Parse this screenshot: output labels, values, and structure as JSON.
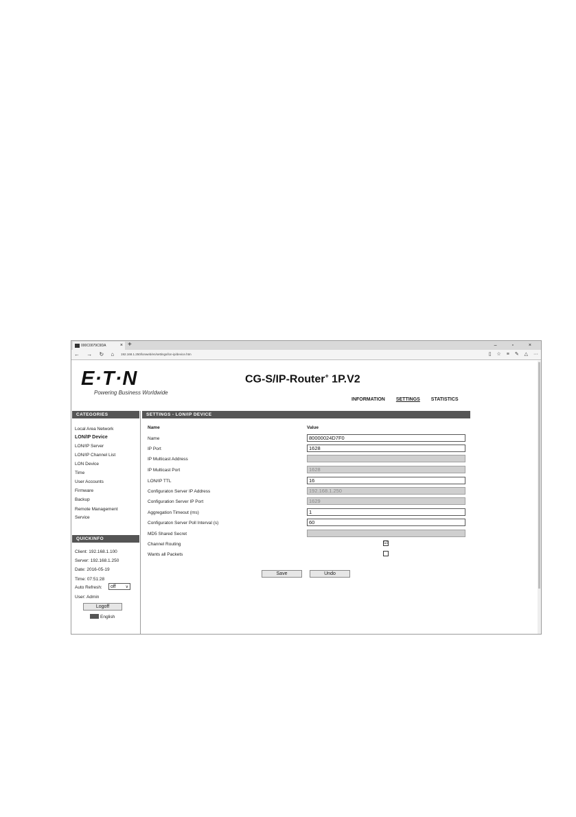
{
  "browser": {
    "tab_title": "000C0079C9DA",
    "tab_close": "×",
    "new_tab": "+",
    "window_controls": "–  ▫  ×",
    "nav": {
      "back": "←",
      "forward": "→",
      "refresh": "↻",
      "home": "⌂"
    },
    "url": "192.168.1.250/lonweb/en/settings/lon-ip/device.htm",
    "tools": {
      "reading": "▯",
      "favorite": "☆",
      "hub": "≡",
      "notes": "✎",
      "share": "△",
      "more": "···"
    }
  },
  "header": {
    "logo_text": "E·T·N",
    "tagline": "Powering Business Worldwide",
    "title": "CG-S/IP-Router",
    "title_sup": "+",
    "title_suffix": " 1P.V2",
    "nav": [
      "INFORMATION",
      "SETTINGS",
      "STATISTICS"
    ]
  },
  "sidebar": {
    "categories_title": "CATEGORIES",
    "categories": [
      "Local Area Network",
      "LON/IP Device",
      "LON/IP Server",
      "LON/IP Channel List",
      "LON Device",
      "Time",
      "User Accounts",
      "Firmware",
      "Backup",
      "Remote Management",
      "Service"
    ],
    "quickinfo_title": "QUICKINFO",
    "client": "Client: 192.168.1.100",
    "server": "Server: 192.168.1.250",
    "date": "Date: 2016-05-19",
    "time": "Time: 07:51:28",
    "auto_refresh_label": "Auto Refresh:",
    "auto_refresh_value": "off",
    "user": "User: Admin",
    "logoff": "Logoff",
    "language": "English"
  },
  "main": {
    "section_title": "SETTINGS - LON/IP DEVICE",
    "col_name": "Name",
    "col_value": "Value",
    "rows": [
      {
        "label": "Name",
        "value": "80000024D7F0"
      },
      {
        "label": "IP Port",
        "value": "1628"
      },
      {
        "label": "IP Multicast Address",
        "value": ""
      },
      {
        "label": "IP Multicast Port",
        "value": "1628"
      },
      {
        "label": "LON/IP TTL",
        "value": "16"
      },
      {
        "label": "Configuraton Server IP Address",
        "value": "192.168.1.250"
      },
      {
        "label": "Configuration Server IP Port",
        "value": "1629"
      },
      {
        "label": "Aggregation Timeout (ms)",
        "value": "1"
      },
      {
        "label": "Configuraton Server Poll Interval (s)",
        "value": "60"
      },
      {
        "label": "MD5 Shared Secret",
        "value": ""
      },
      {
        "label": "Channel Routing",
        "checked": true
      },
      {
        "label": "Wants all Packets",
        "checked": false
      }
    ],
    "check_mark": "☑",
    "save": "Save",
    "undo": "Undo"
  }
}
